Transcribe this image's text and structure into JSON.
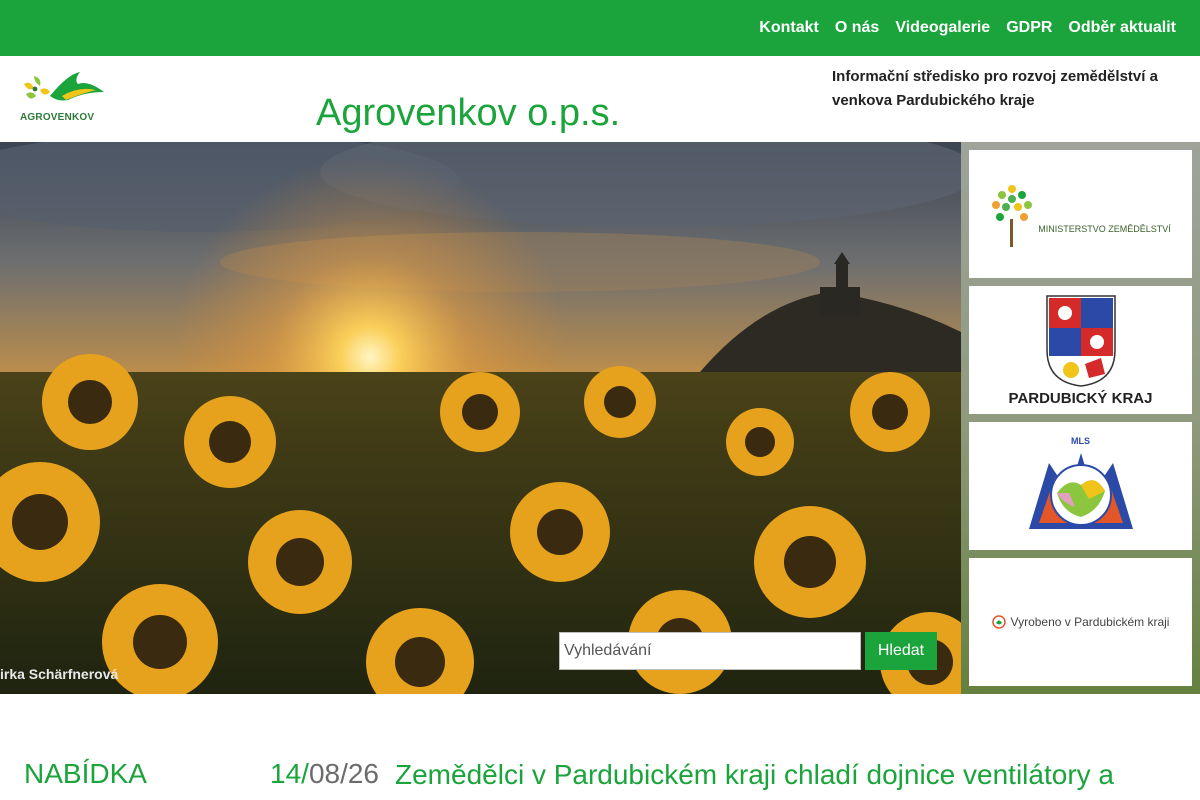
{
  "nav": {
    "items": [
      "Kontakt",
      "O nás",
      "Videogalerie",
      "GDPR",
      "Odběr aktualit"
    ]
  },
  "header": {
    "logo_text": "AGROVENKOV",
    "site_title": "Agrovenkov o.p.s.",
    "tagline": "Informační středisko pro rozvoj zemědělství a venkova Pardubického kraje"
  },
  "hero": {
    "photo_credit": "irka Schärfnerová"
  },
  "search": {
    "placeholder": "Vyhledávání",
    "button_label": "Hledat"
  },
  "partners": [
    {
      "label": "MINISTERSTVO ZEMĚDĚLSTVÍ"
    },
    {
      "label": "PARDUBICKÝ KRAJ"
    },
    {
      "label": "MLS"
    },
    {
      "label": "Vyrobeno v Pardubickém kraji"
    }
  ],
  "content": {
    "sidebar_heading": "NABÍDKA",
    "news": [
      {
        "date_day": "14/",
        "date_rest": "08/26",
        "title": "Zemědělci v Pardubickém kraji chladí dojnice ventilátory a"
      }
    ]
  },
  "colors": {
    "brand_green": "#1aa43b",
    "date_gray": "#6b6b6b"
  }
}
